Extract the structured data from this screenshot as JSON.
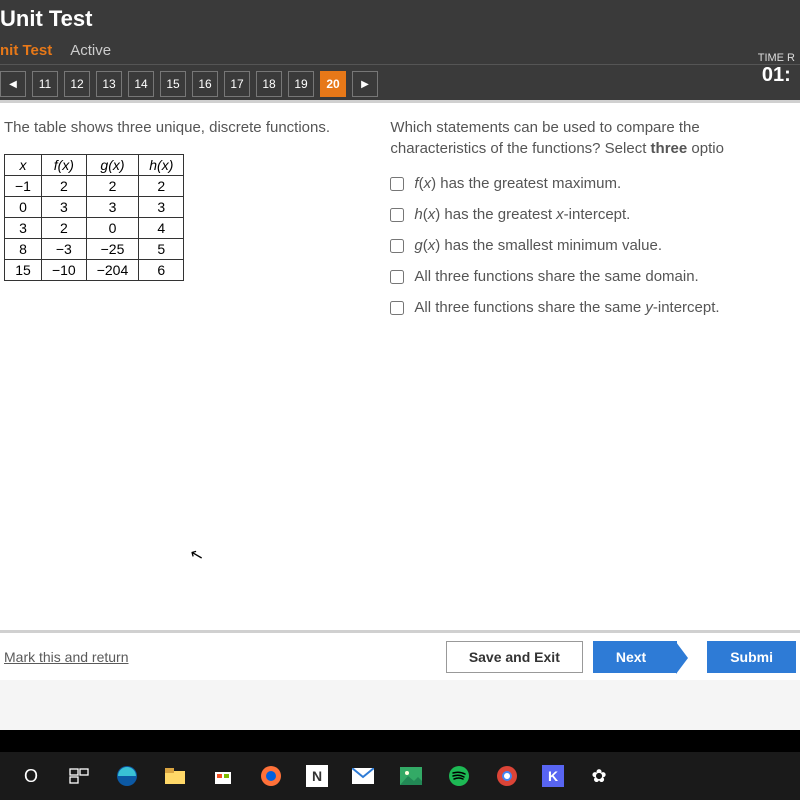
{
  "header": {
    "title": "Unit Test",
    "crumb": "nit Test",
    "active": "Active",
    "timer_label": "TIME R",
    "timer_value": "01:"
  },
  "nav": {
    "prev": "◀",
    "items": [
      "11",
      "12",
      "13",
      "14",
      "15",
      "16",
      "17",
      "18",
      "19",
      "20"
    ],
    "activeIndex": 9,
    "next": "▶"
  },
  "question": {
    "left_prompt": "The table shows three unique, discrete functions.",
    "right_prompt": "Which statements can be used to compare the characteristics of the functions? Select three optio",
    "table": {
      "headers": [
        "x",
        "f(x)",
        "g(x)",
        "h(x)"
      ],
      "rows": [
        [
          "−1",
          "2",
          "2",
          "2"
        ],
        [
          "0",
          "3",
          "3",
          "3"
        ],
        [
          "3",
          "2",
          "0",
          "4"
        ],
        [
          "8",
          "−3",
          "−25",
          "5"
        ],
        [
          "15",
          "−10",
          "−204",
          "6"
        ]
      ]
    },
    "options": [
      "f(x) has the greatest maximum.",
      "h(x) has the greatest x-intercept.",
      "g(x) has the smallest minimum value.",
      "All three functions share the same domain.",
      "All three functions share the same y-intercept."
    ]
  },
  "footer": {
    "mark": "Mark this and return",
    "save": "Save and Exit",
    "next": "Next",
    "submit": "Submi"
  }
}
